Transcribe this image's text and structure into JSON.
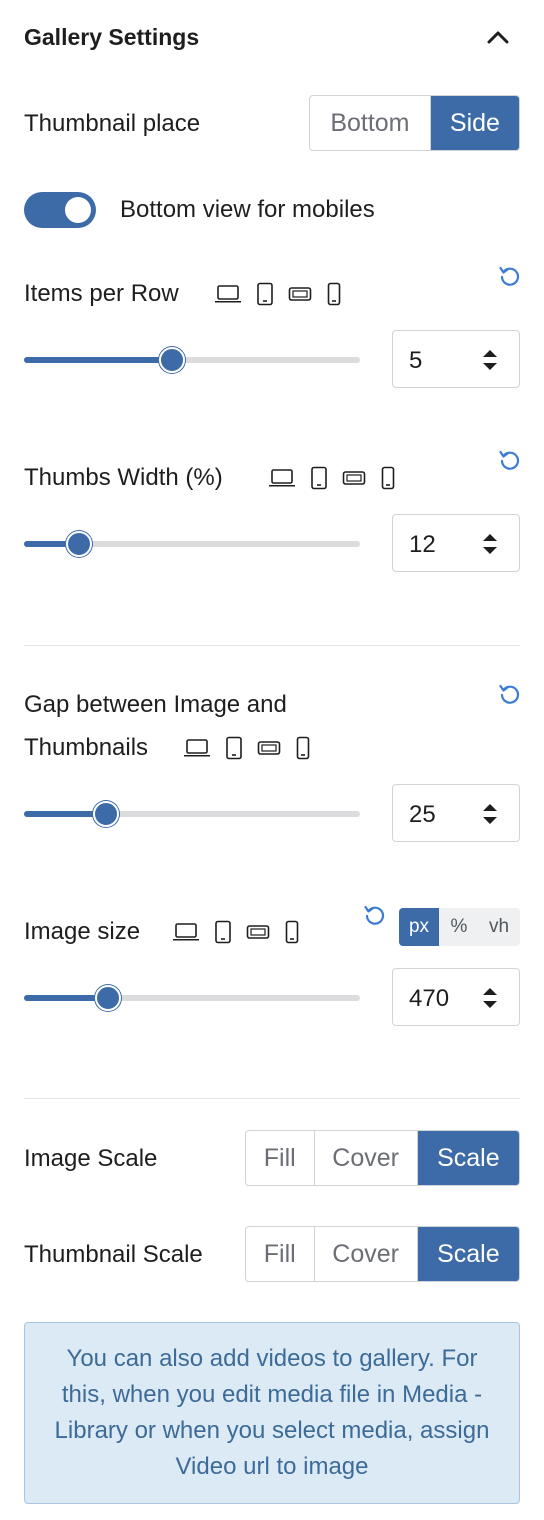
{
  "panel": {
    "title": "Gallery Settings"
  },
  "thumbnail_place": {
    "label": "Thumbnail place",
    "options": [
      "Bottom",
      "Side"
    ],
    "selected": "Side"
  },
  "bottom_view": {
    "label": "Bottom view for mobiles",
    "enabled": true
  },
  "items_per_row": {
    "label": "Items per Row",
    "value": "5",
    "slider_fraction": 0.44
  },
  "thumbs_width": {
    "label": "Thumbs Width (%)",
    "value": "12",
    "slider_fraction": 0.165
  },
  "gap": {
    "label_line1": "Gap between Image and",
    "label_line2": "Thumbnails",
    "value": "25",
    "slider_fraction": 0.245
  },
  "image_size": {
    "label": "Image size",
    "value": "470",
    "slider_fraction": 0.25,
    "units": [
      "px",
      "%",
      "vh"
    ],
    "selected_unit": "px"
  },
  "image_scale": {
    "label": "Image Scale",
    "options": [
      "Fill",
      "Cover",
      "Scale"
    ],
    "selected": "Scale"
  },
  "thumbnail_scale": {
    "label": "Thumbnail Scale",
    "options": [
      "Fill",
      "Cover",
      "Scale"
    ],
    "selected": "Scale"
  },
  "notice": {
    "text": "You can also add videos to gallery. For this, when you edit media file in Media - Library or when you select media, assign Video url to image"
  },
  "colors": {
    "accent": "#3d6ba8",
    "notice_bg": "#dceaf5",
    "notice_text": "#3d6b98",
    "reset_icon": "#3b7bd4"
  },
  "icons": [
    "chevron-up-icon",
    "laptop-icon",
    "tablet-icon",
    "tablet-landscape-icon",
    "mobile-icon",
    "reset-icon",
    "stepper-icon"
  ]
}
